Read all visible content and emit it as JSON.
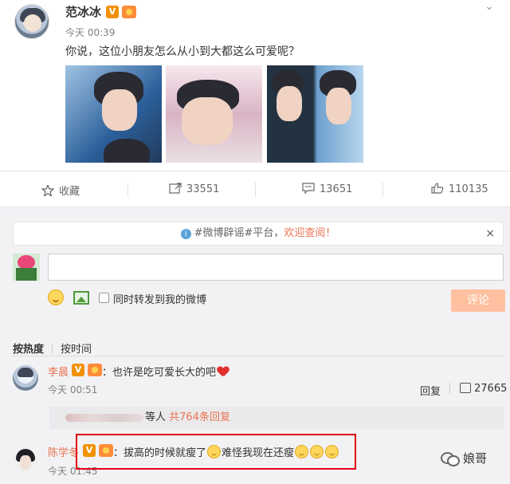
{
  "post": {
    "author": "范冰冰",
    "verified_badge": "V",
    "time": "今天 00:39",
    "text": "你说，这位小朋友怎么从小到大都这么可爱呢？",
    "photos": [
      "photo-1",
      "photo-2",
      "photo-3"
    ]
  },
  "actions": {
    "favorite_label": "收藏",
    "repost_count": "33551",
    "comment_count": "13651",
    "like_count": "110135"
  },
  "notice": {
    "hint_text": "#微博辟谣#平台，",
    "link_text": "欢迎查阅！",
    "close_label": "×"
  },
  "composer": {
    "checkbox_label": "同时转发到我的微博",
    "submit_label": "评论"
  },
  "sort": {
    "hot_label": "按热度",
    "time_label": "按时间"
  },
  "comments": [
    {
      "name": "李晨",
      "badge": "V",
      "text": "：也许是吃可爱长大的吧",
      "time": "今天 00:51",
      "reply_label": "回复",
      "likes": "27665",
      "replies_prefix": "等人",
      "replies_count": "共764条回复"
    },
    {
      "name": "陈学冬",
      "badge": "V",
      "text_part1": "：拔高的时候就瘦了",
      "text_part2": "难怪我现在还瘦",
      "time": "今天 01:45"
    }
  ],
  "watermark": "娘哥",
  "colors": {
    "accent_orange": "#eb7350",
    "highlight_red": "#e60012",
    "submit_disabled": "#ffc09f"
  }
}
